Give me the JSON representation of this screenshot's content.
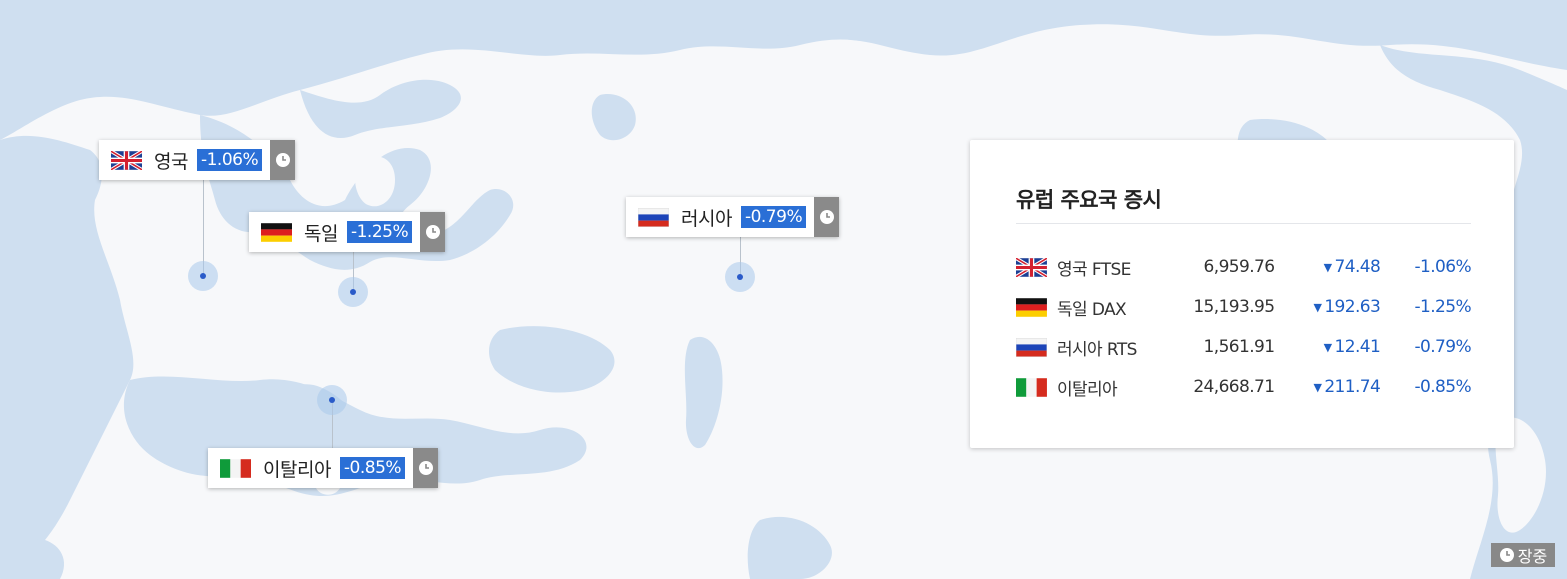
{
  "map": {
    "markers": [
      {
        "id": "uk",
        "name": "영국",
        "pct": "-1.06%",
        "flag": "uk-flag-icon"
      },
      {
        "id": "de",
        "name": "독일",
        "pct": "-1.25%",
        "flag": "germany-flag-icon"
      },
      {
        "id": "ru",
        "name": "러시아",
        "pct": "-0.79%",
        "flag": "russia-flag-icon"
      },
      {
        "id": "it",
        "name": "이탈리아",
        "pct": "-0.85%",
        "flag": "italy-flag-icon"
      }
    ]
  },
  "panel": {
    "title": "유럽 주요국 증시",
    "rows": [
      {
        "flag": "uk-flag-icon",
        "name": "영국 FTSE",
        "value": "6,959.76",
        "change": "74.48",
        "pct": "-1.06%"
      },
      {
        "flag": "germany-flag-icon",
        "name": "독일 DAX",
        "value": "15,193.95",
        "change": "192.63",
        "pct": "-1.25%"
      },
      {
        "flag": "russia-flag-icon",
        "name": "러시아 RTS",
        "value": "1,561.91",
        "change": "12.41",
        "pct": "-0.79%"
      },
      {
        "flag": "italy-flag-icon",
        "name": "이탈리아",
        "value": "24,668.71",
        "change": "211.74",
        "pct": "-0.85%"
      }
    ]
  },
  "status": {
    "label": "장중",
    "icon": "clock-icon"
  },
  "colors": {
    "sea": "#cfdff0",
    "land": "#f7f8fa",
    "accent": "#2a6fd6",
    "down": "#1f5fc4"
  }
}
